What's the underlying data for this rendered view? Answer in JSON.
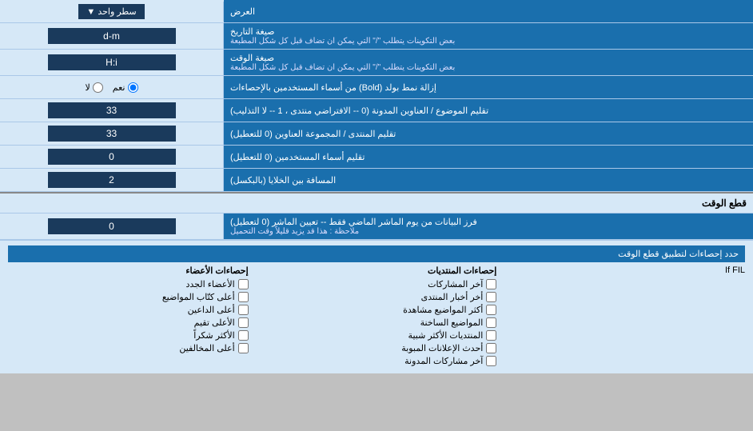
{
  "title": "العرض",
  "rows": [
    {
      "id": "row-display",
      "label": "العرض",
      "input_type": "dropdown",
      "value": "سطر واحد"
    },
    {
      "id": "row-date-format",
      "label": "صيغة التاريخ",
      "sublabel": "بعض التكوينات يتطلب \"/\" التي يمكن ان تضاف قبل كل شكل المطبعة",
      "input_type": "text",
      "value": "d-m"
    },
    {
      "id": "row-time-format",
      "label": "صيغة الوقت",
      "sublabel": "بعض التكوينات يتطلب \"/\" التي يمكن ان تضاف قبل كل شكل المطبعة",
      "input_type": "text",
      "value": "H:i"
    },
    {
      "id": "row-bold",
      "label": "إزالة نمط بولد (Bold) من أسماء المستخدمين بالإحصاءات",
      "input_type": "radio",
      "options": [
        "نعم",
        "لا"
      ],
      "selected": "نعم"
    },
    {
      "id": "row-topics",
      "label": "تقليم الموضوع / العناوين المدونة (0 -- الافتراضي منتدى ، 1 -- لا التذليب)",
      "input_type": "text",
      "value": "33"
    },
    {
      "id": "row-forum-titles",
      "label": "تقليم المنتدى / المجموعة العناوين (0 للتعطيل)",
      "input_type": "text",
      "value": "33"
    },
    {
      "id": "row-usernames",
      "label": "تقليم أسماء المستخدمين (0 للتعطيل)",
      "input_type": "text",
      "value": "0"
    },
    {
      "id": "row-spacing",
      "label": "المسافة بين الخلايا (بالبكسل)",
      "input_type": "text",
      "value": "2"
    }
  ],
  "section_cut": {
    "title": "قطع الوقت",
    "rows": [
      {
        "id": "row-cutoff",
        "label": "فرز البيانات من يوم الماشر الماضي فقط -- تعيين الماشر (0 لتعطيل)",
        "sublabel": "ملاحظة : هذا قد يزيد قليلاً وقت التحميل",
        "input_type": "text",
        "value": "0"
      }
    ]
  },
  "checkboxes_section": {
    "title": "حدد إحصاءات لتطبيق قطع الوقت",
    "col1_header": "إحصاءات الأعضاء",
    "col1_items": [
      "الأعضاء الجدد",
      "أعلى كتّاب المواضيع",
      "أعلى الداعين",
      "الأعلى تقيم",
      "الأكثر شكراً",
      "أعلى المخالفين"
    ],
    "col2_header": "إحصاءات المنتديات",
    "col2_items": [
      "آخر المشاركات",
      "أخر أخبار المنتدى",
      "أكثر المواضيع مشاهدة",
      "المواضيع الساخنة",
      "المنتديات الأكثر شبية",
      "أحدث الإعلانات المبوبة",
      "آخر مشاركات المدونة"
    ],
    "col3_note": "If FIL"
  }
}
